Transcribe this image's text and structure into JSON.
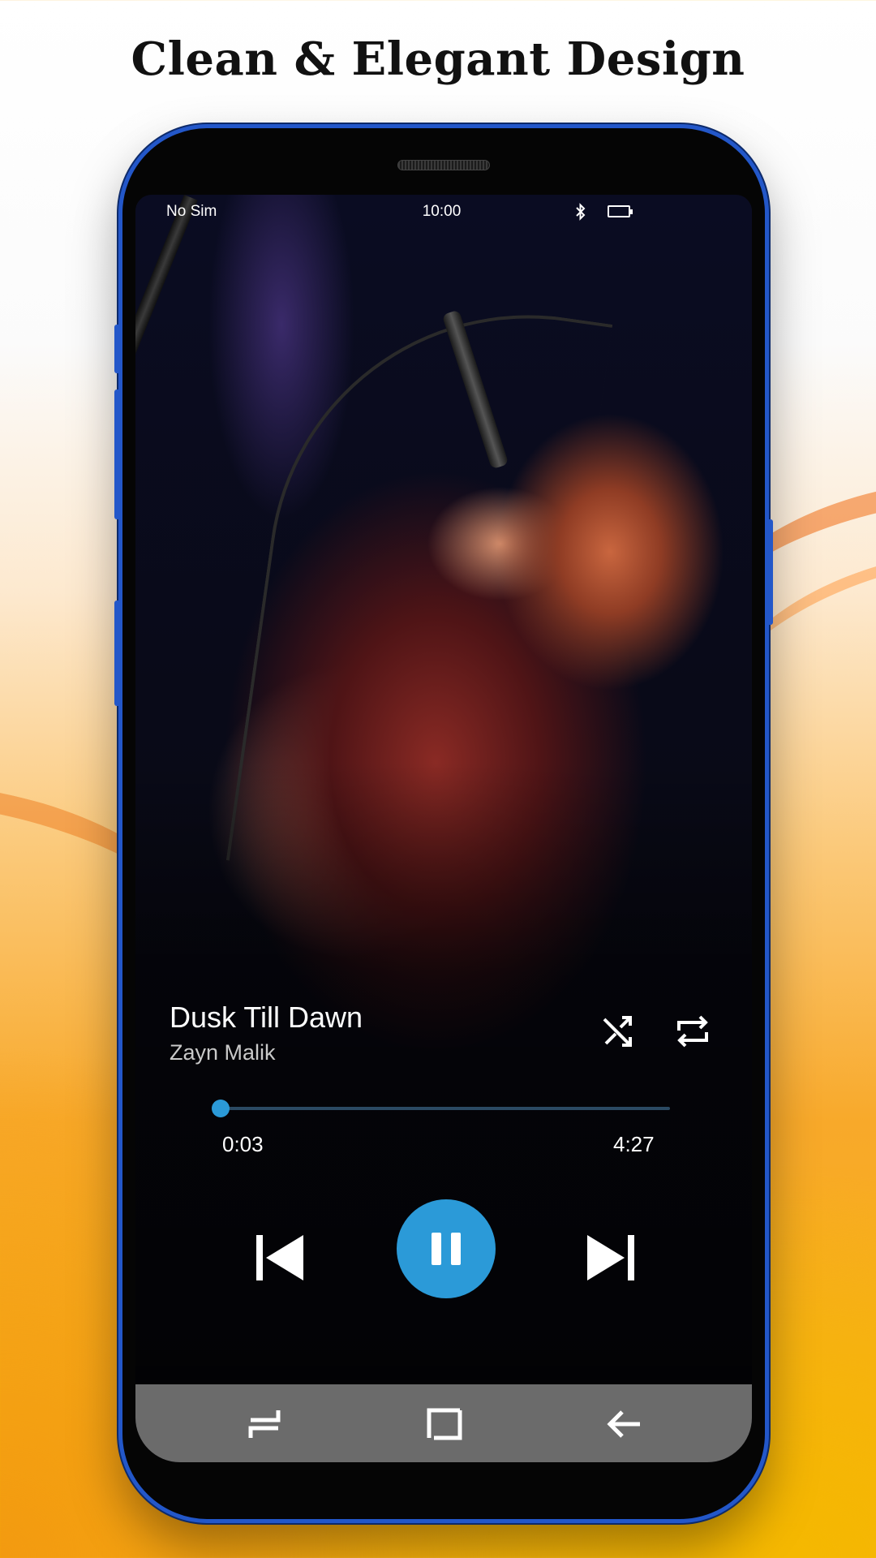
{
  "promo": {
    "headline": "Clean & Elegant Design"
  },
  "status_bar": {
    "carrier": "No Sim",
    "time": "10:00",
    "icons": [
      "bluetooth-icon",
      "battery-icon"
    ]
  },
  "player": {
    "title": "Dusk Till Dawn",
    "artist": "Zayn Malik",
    "elapsed": "0:03",
    "duration": "4:27",
    "progress_fraction": 0.011,
    "state": "playing",
    "accent_color": "#2b9ad8",
    "icons": [
      "shuffle-icon",
      "repeat-icon",
      "skip-previous-icon",
      "pause-icon",
      "skip-next-icon"
    ]
  },
  "nav_bar": {
    "icons": [
      "recent-apps-icon",
      "home-icon",
      "back-icon"
    ]
  }
}
